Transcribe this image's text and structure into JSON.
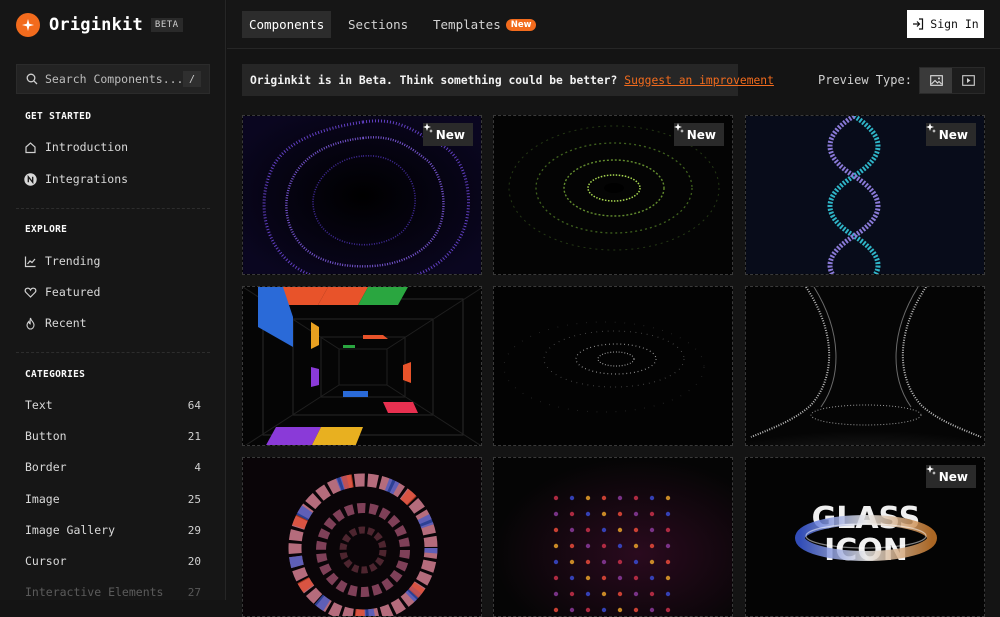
{
  "brand": {
    "name": "Originkit",
    "badge": "BETA",
    "accent": "#f26b1d"
  },
  "search": {
    "placeholder": "Search Components...",
    "shortcut": "/"
  },
  "sidebar": {
    "get_started": {
      "title": "GET STARTED",
      "items": [
        {
          "label": "Introduction",
          "icon": "home-icon"
        },
        {
          "label": "Integrations",
          "icon": "n-logo-icon"
        }
      ]
    },
    "explore": {
      "title": "EXPLORE",
      "items": [
        {
          "label": "Trending",
          "icon": "trending-icon"
        },
        {
          "label": "Featured",
          "icon": "heart-icon"
        },
        {
          "label": "Recent",
          "icon": "flame-icon"
        }
      ]
    },
    "categories": {
      "title": "CATEGORIES",
      "items": [
        {
          "label": "Text",
          "count": "64"
        },
        {
          "label": "Button",
          "count": "21"
        },
        {
          "label": "Border",
          "count": "4"
        },
        {
          "label": "Image",
          "count": "25"
        },
        {
          "label": "Image Gallery",
          "count": "29"
        },
        {
          "label": "Cursor",
          "count": "20"
        },
        {
          "label": "Interactive Elements",
          "count": "27"
        }
      ]
    }
  },
  "topbar": {
    "tabs": [
      {
        "label": "Components",
        "active": true
      },
      {
        "label": "Sections",
        "active": false
      },
      {
        "label": "Templates",
        "active": false,
        "pill": "New"
      }
    ],
    "sign_in": "Sign In"
  },
  "notice": {
    "text": "Originkit is in Beta. Think something could be better?",
    "link": "Suggest an improvement"
  },
  "preview": {
    "label": "Preview Type:",
    "options": [
      "image-icon",
      "video-icon"
    ],
    "selected": "image-icon"
  },
  "cards": [
    {
      "badge": "New"
    },
    {
      "badge": "New"
    },
    {
      "badge": "New"
    },
    {
      "badge": ""
    },
    {
      "badge": ""
    },
    {
      "badge": ""
    },
    {
      "badge": ""
    },
    {
      "badge": ""
    },
    {
      "badge": "New",
      "art_text": [
        "GLASS",
        "ICON"
      ]
    }
  ]
}
